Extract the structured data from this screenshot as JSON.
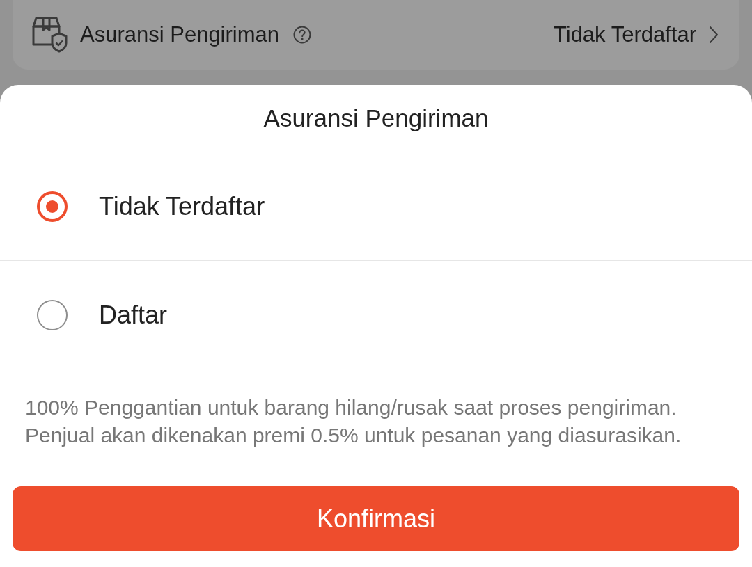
{
  "background_row": {
    "label": "Asuransi Pengiriman",
    "value": "Tidak Terdaftar"
  },
  "sheet": {
    "title": "Asuransi Pengiriman",
    "options": [
      {
        "label": "Tidak Terdaftar",
        "selected": true
      },
      {
        "label": "Daftar",
        "selected": false
      }
    ],
    "description": [
      "100% Penggantian untuk barang hilang/rusak saat proses pengiriman.",
      "Penjual akan dikenakan premi 0.5% untuk pesanan yang diasurasikan."
    ],
    "confirm_button": "Konfirmasi"
  }
}
